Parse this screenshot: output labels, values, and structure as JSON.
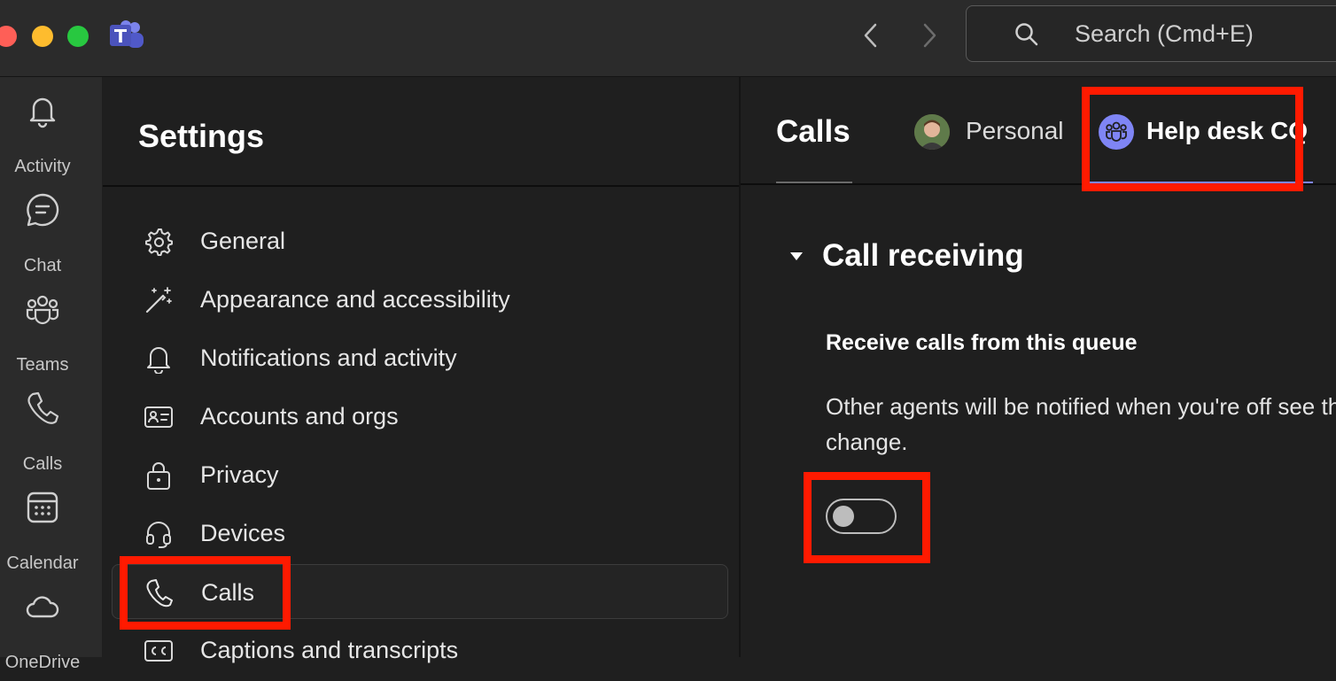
{
  "app": {
    "name": "Microsoft Teams"
  },
  "toolbar": {
    "search_placeholder": "Search (Cmd+E)"
  },
  "rail": {
    "items": [
      {
        "label": "Activity",
        "icon": "bell-icon"
      },
      {
        "label": "Chat",
        "icon": "chat-icon"
      },
      {
        "label": "Teams",
        "icon": "teams-icon"
      },
      {
        "label": "Calls",
        "icon": "phone-icon"
      },
      {
        "label": "Calendar",
        "icon": "calendar-icon"
      },
      {
        "label": "OneDrive",
        "icon": "cloud-icon"
      }
    ]
  },
  "settings": {
    "title": "Settings",
    "menu": [
      {
        "label": "General",
        "icon": "gear-icon"
      },
      {
        "label": "Appearance and accessibility",
        "icon": "magic-wand-icon"
      },
      {
        "label": "Notifications and activity",
        "icon": "bell-icon"
      },
      {
        "label": "Accounts and orgs",
        "icon": "id-card-icon"
      },
      {
        "label": "Privacy",
        "icon": "lock-icon"
      },
      {
        "label": "Devices",
        "icon": "headset-icon"
      },
      {
        "label": "Calls",
        "icon": "phone-icon",
        "active": true
      },
      {
        "label": "Captions and transcripts",
        "icon": "cc-icon"
      }
    ]
  },
  "calls": {
    "page_title": "Calls",
    "tabs": [
      {
        "label": "Personal"
      },
      {
        "label": "Help desk CQ",
        "selected": true
      }
    ],
    "section": {
      "title": "Call receiving",
      "setting_title": "Receive calls from this queue",
      "description": "Other agents will be notified when you're off see the change.",
      "toggle_on": false
    }
  },
  "colors": {
    "accent": "#7f85f5",
    "highlight": "#ff1a00"
  }
}
